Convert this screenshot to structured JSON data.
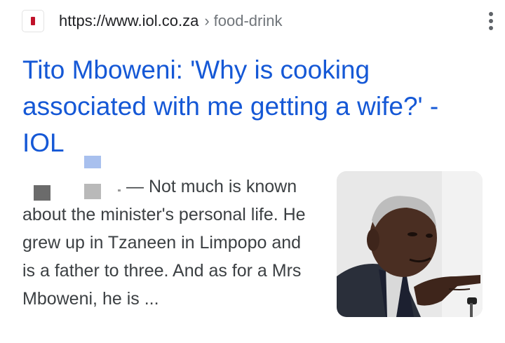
{
  "result": {
    "source": {
      "favicon_icon": "iol-favicon-icon",
      "url_base": "https://www.iol.co.za",
      "separator": "›",
      "url_path": "food-drink"
    },
    "more_icon": "more-vert-icon",
    "title": "Tito Mboweni: 'Why is cooking associated with me getting a wife?' - IOL",
    "snippet": "— Not much is known about the minister's personal life. He grew up in Tzaneen in Limpopo and is a father to three. And as for a Mrs Mboweni, he is ...",
    "thumbnail_icon": "article-thumbnail-photo"
  },
  "colors": {
    "title_link": "#1558d6",
    "url_text": "#202124",
    "snippet_text": "#3c4043",
    "favicon_accent": "#c0122a"
  }
}
